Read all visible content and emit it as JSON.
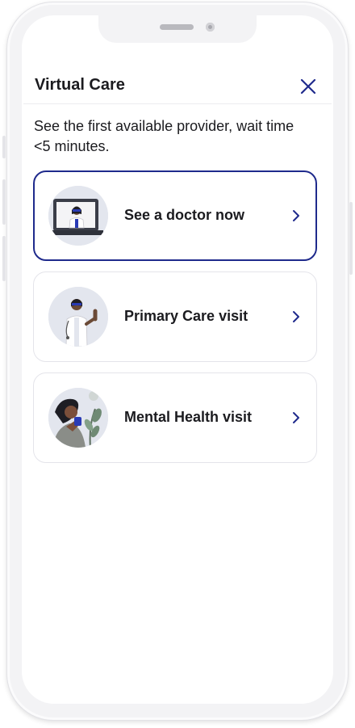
{
  "header": {
    "title": "Virtual Care",
    "close_icon": "close-icon"
  },
  "subtitle": "See the first available provider, wait time <5 minutes.",
  "options": [
    {
      "label": "See a doctor now",
      "icon": "doctor-on-screen-illustration",
      "selected": true
    },
    {
      "label": "Primary Care visit",
      "icon": "doctor-waving-illustration",
      "selected": false
    },
    {
      "label": "Mental Health visit",
      "icon": "person-with-plant-illustration",
      "selected": false
    }
  ],
  "colors": {
    "accent": "#1f2a8c",
    "text": "#1b1b1f",
    "card_border": "#e4e4ea"
  }
}
